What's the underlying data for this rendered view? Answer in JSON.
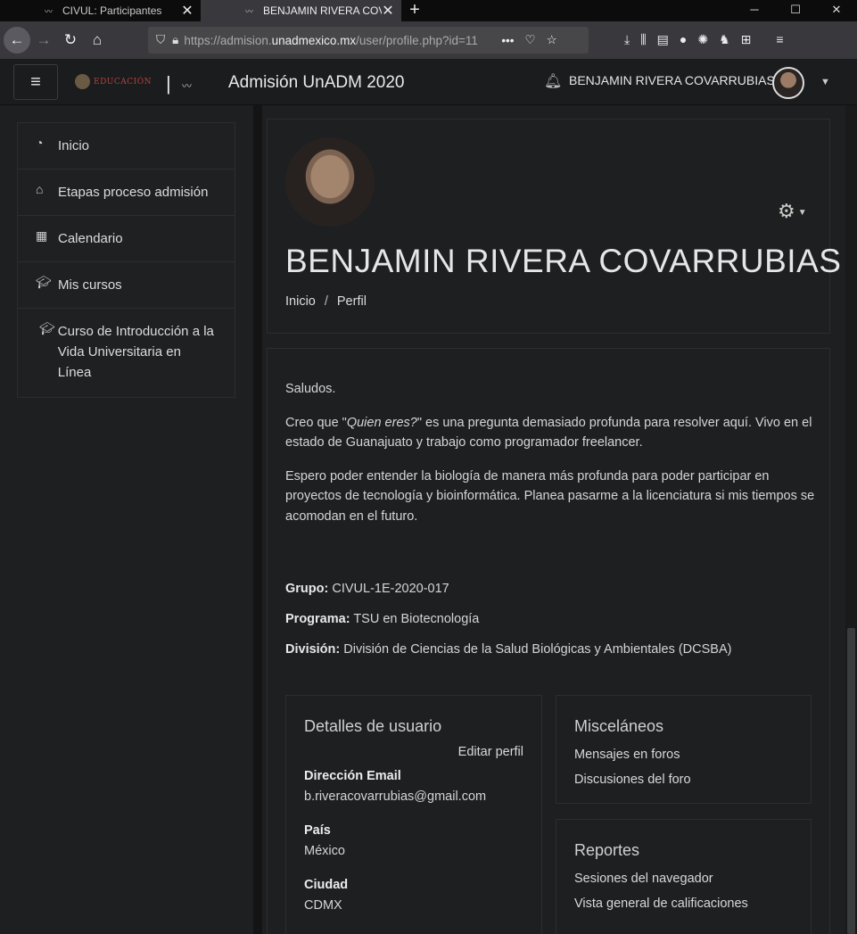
{
  "browser": {
    "tabs": [
      {
        "title": "CIVUL: Participantes",
        "active": false
      },
      {
        "title": "BENJAMIN RIVERA COVARRUBIAS",
        "active": true
      }
    ],
    "url_prefix": "https://admision.",
    "url_domain": "unadmexico.mx",
    "url_suffix": "/user/profile.php?id=11",
    "new_tab_icon": "plus-icon"
  },
  "header": {
    "logo_text": "EDUCACIÓN",
    "site_title": "Admisión UnADM 2020",
    "user_name": "BENJAMIN RIVERA COVARRUBIAS"
  },
  "sidebar": {
    "items": [
      {
        "label": "Inicio",
        "icon": "dashboard-icon"
      },
      {
        "label": "Etapas proceso admisión",
        "icon": "home-icon"
      },
      {
        "label": "Calendario",
        "icon": "calendar-icon"
      },
      {
        "label": "Mis cursos",
        "icon": "graduation-cap-icon"
      },
      {
        "label": "Curso de Introducción a la Vida Universitaria en Línea",
        "icon": "graduation-cap-icon"
      }
    ]
  },
  "profile": {
    "full_name": "BENJAMIN RIVERA COVARRUBIAS",
    "breadcrumb": [
      "Inicio",
      "Perfil"
    ],
    "description": {
      "greeting": "Saludos.",
      "p1_before": "Creo que \"",
      "p1_italic": "Quien eres?",
      "p1_after": "\" es una pregunta demasiado profunda para resolver aquí. Vivo en el estado de Guanajuato y trabajo como programador freelancer.",
      "p2": "Espero poder entender la biología de manera más profunda para poder participar en proyectos de tecnología y bioinformática. Planea pasarme a la licenciatura si mis tiempos se acomodan en el futuro."
    },
    "fields": [
      {
        "label": "Grupo:",
        "value": "CIVUL-1E-2020-017"
      },
      {
        "label": "Programa:",
        "value": "TSU en Biotecnología"
      },
      {
        "label": "División:",
        "value": "División de Ciencias de la Salud Biológicas y Ambientales (DCSBA)"
      }
    ]
  },
  "user_details": {
    "title": "Detalles de usuario",
    "edit_label": "Editar perfil",
    "email_label": "Dirección Email",
    "email": "b.riveracovarrubias@gmail.com",
    "country_label": "País",
    "country": "México",
    "city_label": "Ciudad",
    "city": "CDMX"
  },
  "misc": {
    "title": "Misceláneos",
    "links": [
      "Mensajes en foros",
      "Discusiones del foro"
    ]
  },
  "reports": {
    "title": "Reportes",
    "links": [
      "Sesiones del navegador",
      "Vista general de calificaciones"
    ]
  }
}
